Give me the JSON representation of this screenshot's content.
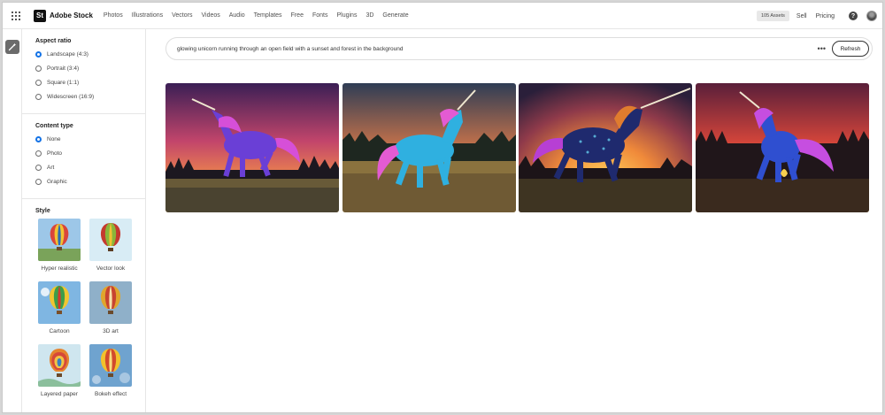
{
  "header": {
    "brand_logo": "St",
    "brand_name": "Adobe Stock",
    "nav": [
      "Photos",
      "Illustrations",
      "Vectors",
      "Videos",
      "Audio",
      "Templates",
      "Free",
      "Fonts",
      "Plugins",
      "3D",
      "Generate"
    ],
    "assets_badge": "105 Assets",
    "sell": "Sell",
    "pricing": "Pricing",
    "help_glyph": "?"
  },
  "filters": {
    "aspect_ratio": {
      "title": "Aspect ratio",
      "options": [
        "Landscape (4:3)",
        "Portrait (3:4)",
        "Square (1:1)",
        "Widescreen (16:9)"
      ],
      "selected": "Landscape (4:3)"
    },
    "content_type": {
      "title": "Content type",
      "options": [
        "None",
        "Photo",
        "Art",
        "Graphic"
      ],
      "selected": "None"
    },
    "style": {
      "title": "Style",
      "options": [
        "Hyper realistic",
        "Vector look",
        "Cartoon",
        "3D art",
        "Layered paper",
        "Bokeh effect"
      ]
    }
  },
  "search": {
    "query": "glowing unicorn running through an open field with a sunset and forest in the background",
    "more_glyph": "•••",
    "refresh_label": "Refresh"
  },
  "results": {
    "count_shown": 4
  },
  "colors": {
    "accent": "#1473e6"
  }
}
